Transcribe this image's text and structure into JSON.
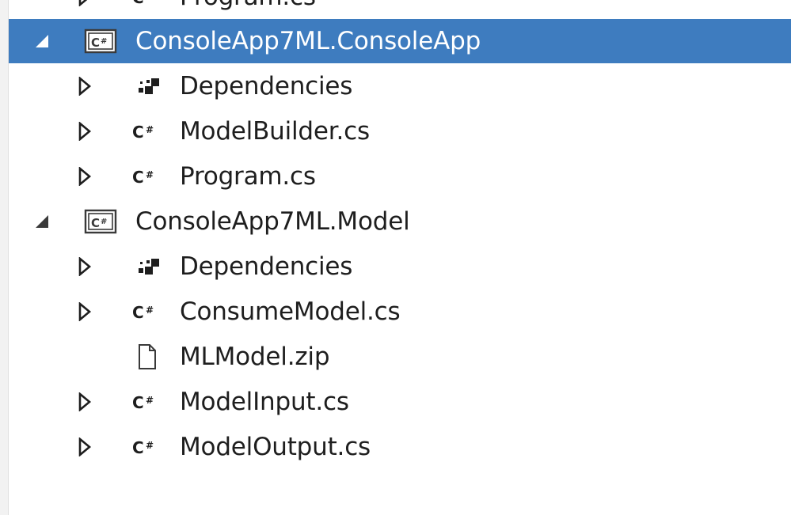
{
  "colors": {
    "selection": "#3e7cbf",
    "text": "#1e1e1e",
    "icon": "#1e1e1e"
  },
  "tree": {
    "items": [
      {
        "label": "Program.cs",
        "depth": 1,
        "expander": "collapsed",
        "icon": "csharp-file-icon",
        "selected": false
      },
      {
        "label": "ConsoleApp7ML.ConsoleApp",
        "depth": 0,
        "expander": "expanded",
        "icon": "csharp-project-icon",
        "selected": true
      },
      {
        "label": "Dependencies",
        "depth": 1,
        "expander": "collapsed",
        "icon": "dependencies-icon",
        "selected": false
      },
      {
        "label": "ModelBuilder.cs",
        "depth": 1,
        "expander": "collapsed",
        "icon": "csharp-file-icon",
        "selected": false
      },
      {
        "label": "Program.cs",
        "depth": 1,
        "expander": "collapsed",
        "icon": "csharp-file-icon",
        "selected": false
      },
      {
        "label": "ConsoleApp7ML.Model",
        "depth": 0,
        "expander": "expanded",
        "icon": "csharp-project-icon",
        "selected": false
      },
      {
        "label": "Dependencies",
        "depth": 1,
        "expander": "collapsed",
        "icon": "dependencies-icon",
        "selected": false
      },
      {
        "label": "ConsumeModel.cs",
        "depth": 1,
        "expander": "collapsed",
        "icon": "csharp-file-icon",
        "selected": false
      },
      {
        "label": "MLModel.zip",
        "depth": 1,
        "expander": "none",
        "icon": "file-icon",
        "selected": false
      },
      {
        "label": "ModelInput.cs",
        "depth": 1,
        "expander": "collapsed",
        "icon": "csharp-file-icon",
        "selected": false
      },
      {
        "label": "ModelOutput.cs",
        "depth": 1,
        "expander": "collapsed",
        "icon": "csharp-file-icon",
        "selected": false
      }
    ]
  }
}
